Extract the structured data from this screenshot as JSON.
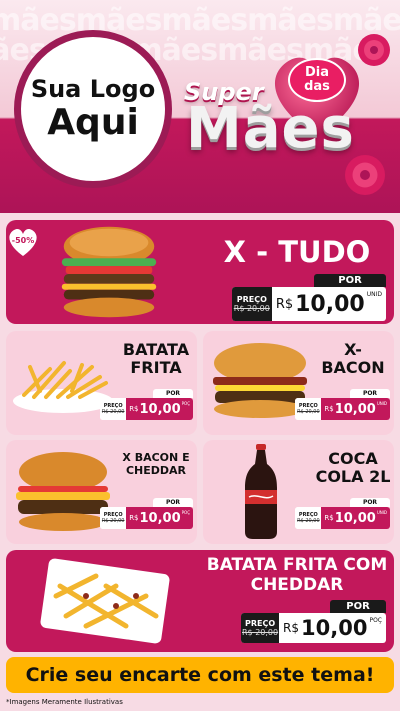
{
  "header": {
    "background_words": "mãesmãesmãesmãesmães",
    "logo_line1": "Sua Logo",
    "logo_line2": "Aqui",
    "title_super": "Super",
    "title_badge_line1": "Dia",
    "title_badge_line2": "das",
    "title_main": "Mães"
  },
  "discount_badge": "-50%",
  "products": [
    {
      "name": "X - TUDO",
      "por": "POR",
      "old_label": "PREÇO",
      "old_value": "R$ 20,00",
      "currency": "R$",
      "price": "10,00",
      "unit": "UNID"
    },
    {
      "name_line1": "BATATA",
      "name_line2": "FRITA",
      "por": "POR",
      "old_label": "PREÇO",
      "old_value": "R$ 20,00",
      "currency": "R$",
      "price": "10,00",
      "unit": "POÇ"
    },
    {
      "name_line1": "X-",
      "name_line2": "BACON",
      "por": "POR",
      "old_label": "PREÇO",
      "old_value": "R$ 20,00",
      "currency": "R$",
      "price": "10,00",
      "unit": "UNID"
    },
    {
      "name_line1": "X BACON E",
      "name_line2": "CHEDDAR",
      "por": "POR",
      "old_label": "PREÇO",
      "old_value": "R$ 20,00",
      "currency": "R$",
      "price": "10,00",
      "unit": "POÇ"
    },
    {
      "name_line1": "COCA",
      "name_line2": "COLA 2L",
      "por": "POR",
      "old_label": "PREÇO",
      "old_value": "R$ 20,00",
      "currency": "R$",
      "price": "10,00",
      "unit": "UNID"
    },
    {
      "name_line1": "BATATA FRITA COM",
      "name_line2": "CHEDDAR",
      "por": "POR",
      "old_label": "PREÇO",
      "old_value": "R$ 20,00",
      "currency": "R$",
      "price": "10,00",
      "unit": "POÇ"
    }
  ],
  "cta": "Crie seu encarte com este tema!",
  "footnote": "*Imagens Meramente Ilustrativas",
  "colors": {
    "magenta": "#c2185b",
    "pink_light": "#f9d0dd",
    "yellow": "#ffb300",
    "dark": "#1a1a1a"
  }
}
